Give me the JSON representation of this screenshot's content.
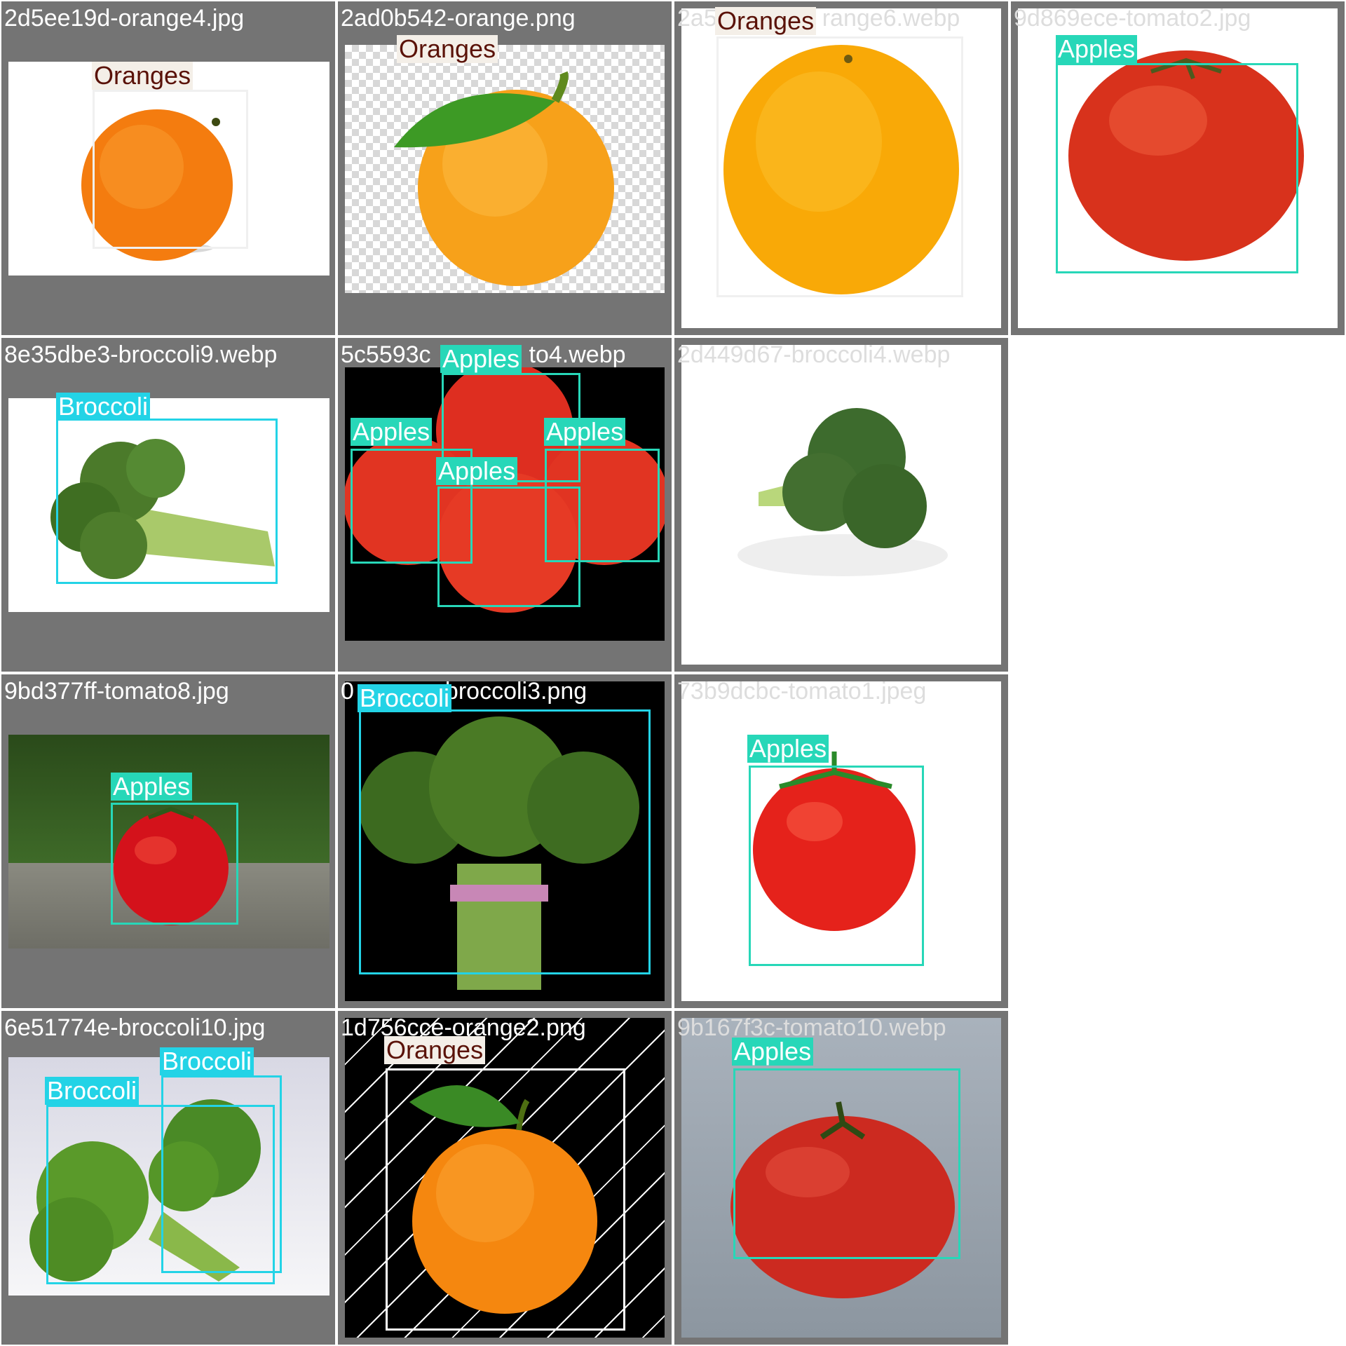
{
  "tiles": [
    {
      "filename": "2d5ee19d-orange4.jpg",
      "labels": [
        "Oranges"
      ]
    },
    {
      "filename": "2ad0b542-orange.png",
      "labels": [
        "Oranges"
      ]
    },
    {
      "filename": "2a5",
      "filename_tail": "range6.webp",
      "labels": [
        "Oranges"
      ]
    },
    {
      "filename": "9d869ece-tomato2.jpg",
      "labels": [
        "Apples"
      ]
    },
    {
      "filename": "8e35dbe3-broccoli9.webp",
      "labels": [
        "Broccoli"
      ]
    },
    {
      "filename": "5c5593c",
      "filename_tail": "to4.webp",
      "labels": [
        "Apples",
        "Apples",
        "Apples",
        "Apples"
      ]
    },
    {
      "filename": "2d449d67-broccoli4.webp",
      "labels": []
    },
    {
      "filename": "9bd377ff-tomato8.jpg",
      "labels": [
        "Apples"
      ]
    },
    {
      "filename": "0",
      "filename_tail": "broccoli3.png",
      "labels": [
        "Broccoli"
      ]
    },
    {
      "filename": "73b9dcbc-tomato1.jpeg",
      "labels": [
        "Apples"
      ]
    },
    {
      "filename": "6e51774e-broccoli10.jpg",
      "labels": [
        "Broccoli",
        "Broccoli"
      ]
    },
    {
      "filename": "1d756cce-orange2.png",
      "labels": [
        "Oranges"
      ]
    },
    {
      "filename": "9b167f3c-tomato10.webp",
      "labels": [
        "Apples"
      ]
    }
  ],
  "colors": {
    "tile_background": "#747474",
    "orange_label": "#f4efe8",
    "apple_label": "#27d7b8",
    "broccoli_label": "#23d3e6"
  }
}
